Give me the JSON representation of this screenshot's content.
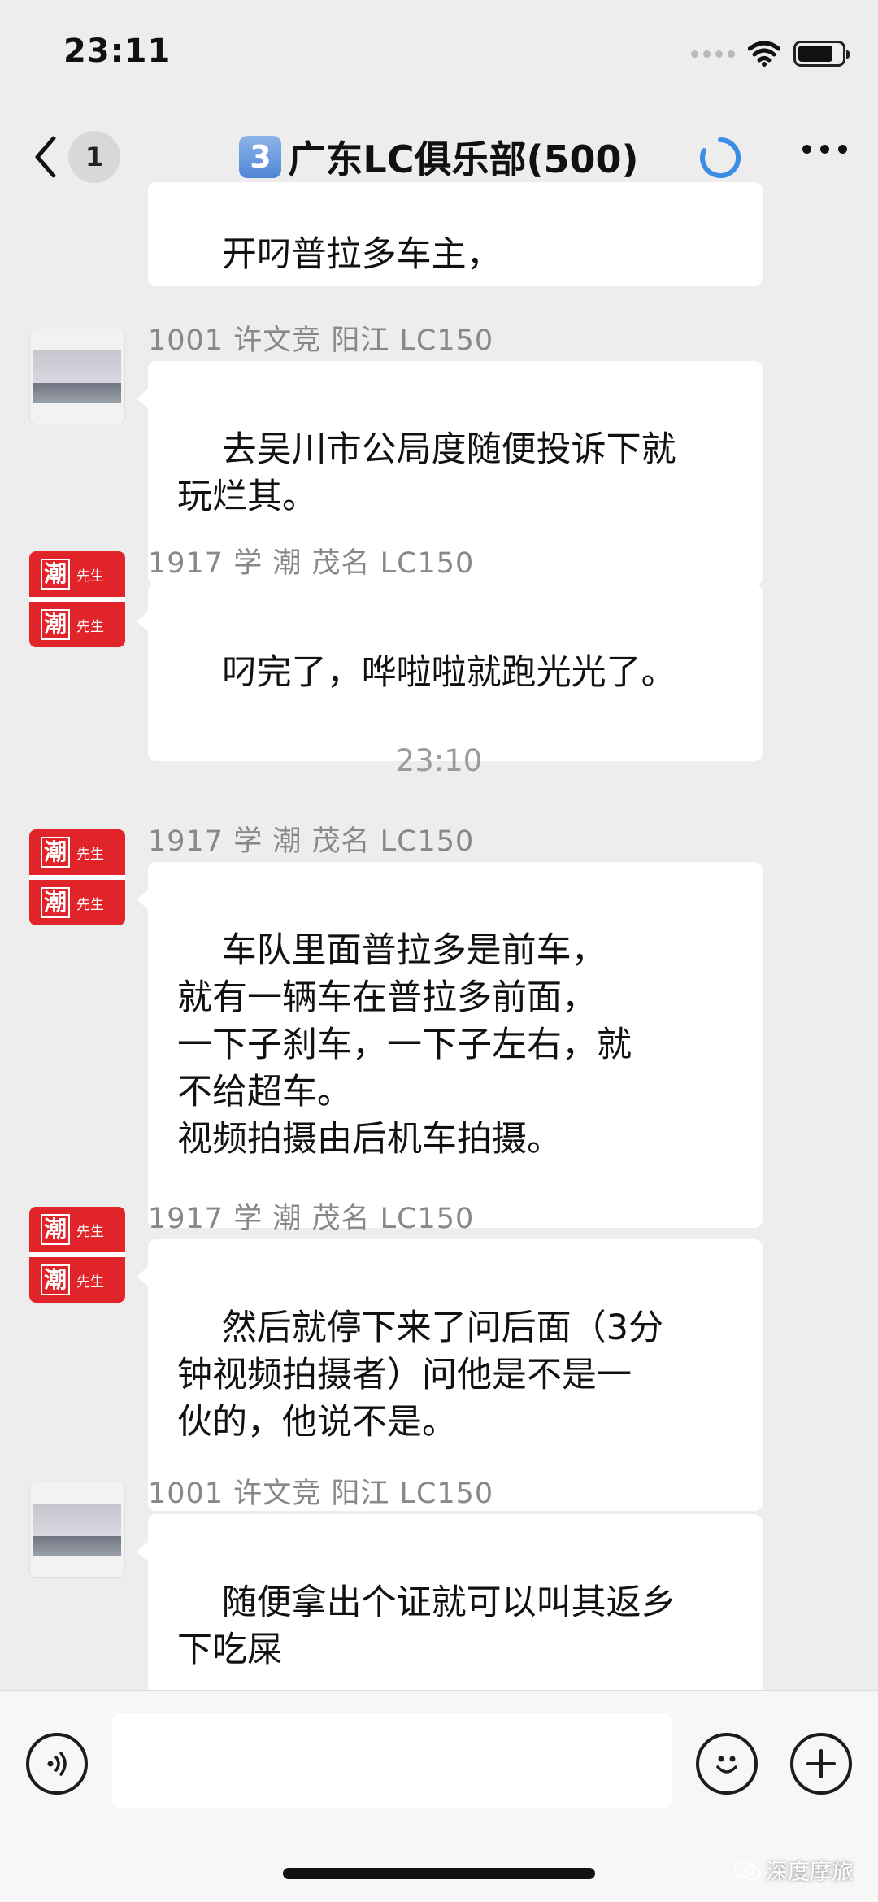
{
  "status_bar": {
    "time": "23:11"
  },
  "nav": {
    "back_count": "1",
    "group_badge": "3",
    "title": "广东LC俱乐部(500)"
  },
  "messages": [
    {
      "sender": "",
      "text": "开叼普拉多车主，",
      "avatar": "red"
    },
    {
      "sender": "1001 许文竞 阳江  LC150",
      "text": "去吴川市公局度随便投诉下就\n玩烂其。",
      "avatar": "photo"
    },
    {
      "sender": "1917 学 潮 茂名  LC150",
      "text": "叼完了，哗啦啦就跑光光了。",
      "avatar": "red"
    },
    {
      "sender": "1917 学 潮 茂名  LC150",
      "text": "车队里面普拉多是前车，\n就有一辆车在普拉多前面，\n一下子刹车，一下子左右，就\n不给超车。\n视频拍摄由后机车拍摄。",
      "avatar": "red"
    },
    {
      "sender": "1917 学 潮 茂名  LC150",
      "text": "然后就停下来了问后面（3分\n钟视频拍摄者）问他是不是一\n伙的，他说不是。",
      "avatar": "red"
    },
    {
      "sender": "1001 许文竞 阳江  LC150",
      "text": "随便拿出个证就可以叫其返乡\n下吃屎",
      "avatar": "photo"
    }
  ],
  "time_separator": "23:10",
  "avatar_red": {
    "big": "潮",
    "small": "先生"
  },
  "input": {
    "placeholder": ""
  },
  "watermark": "深度摩旅",
  "colors": {
    "accent_red": "#e1242a",
    "loading_blue": "#3a8ee6",
    "background": "#ededed"
  },
  "icons": {
    "back": "chevron-left-icon",
    "loading": "loading-spinner-icon",
    "more": "more-dots-icon",
    "voice": "voice-icon",
    "emoji": "emoji-icon",
    "plus": "plus-icon"
  }
}
